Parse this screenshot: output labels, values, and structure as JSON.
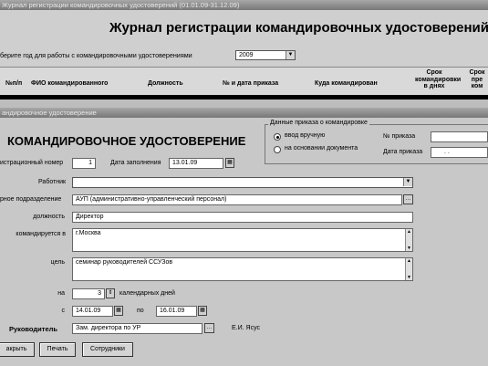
{
  "journal": {
    "window_title": "Журнал регистрации командировочных удостоверений (01.01.09-31.12.09)",
    "title": "Журнал регистрации командировочных удостоверений",
    "year_label": "берите год для работы с командировочными удостоверениями",
    "year_value": "2009",
    "columns": [
      "№п/п",
      "ФИО командированного",
      "Должность",
      "№ и дата приказа",
      "Куда командирован",
      "Срок командировки в днях",
      "Срок пре ком"
    ]
  },
  "dialog": {
    "window_title": "андировочное удостоверение",
    "heading": "КОМАНДИРОВОЧНОЕ УДОСТОВЕРЕНИЕ",
    "order_group": {
      "legend": "Данные приказа о командировке",
      "radio_manual": "ввод вручную",
      "radio_doc": "на основании документа",
      "order_no_label": "№ приказа",
      "order_no_value": "",
      "order_date_label": "Дата приказа",
      "order_date_value": ". ."
    },
    "reg_no_label": "истрационный номер",
    "reg_no_value": "1",
    "fill_date_label": "Дата заполнения",
    "fill_date_value": "13.01.09",
    "worker_label": "Работник",
    "worker_value": "",
    "unit_label": "рное подразделение",
    "unit_value": "АУП (административно-управленческий персонал)",
    "position_label": "должность",
    "position_value": "Директор",
    "destination_label": "командируется в",
    "destination_value": "г.Москва",
    "purpose_label": "цель",
    "purpose_value": "семинар руководителей ССУЗов",
    "duration_label": "на",
    "duration_value": "3",
    "duration_unit": "календарных дней",
    "from_label": "с",
    "from_value": "14.01.09",
    "to_label": "по",
    "to_value": "16.01.09",
    "head_label": "Руководитель",
    "head_value": "Зам. директора по УР",
    "head_name": "Е.И. Ясус",
    "buttons": {
      "close": "акрыть",
      "print": "Печать",
      "employees": "Сотрудники"
    }
  }
}
